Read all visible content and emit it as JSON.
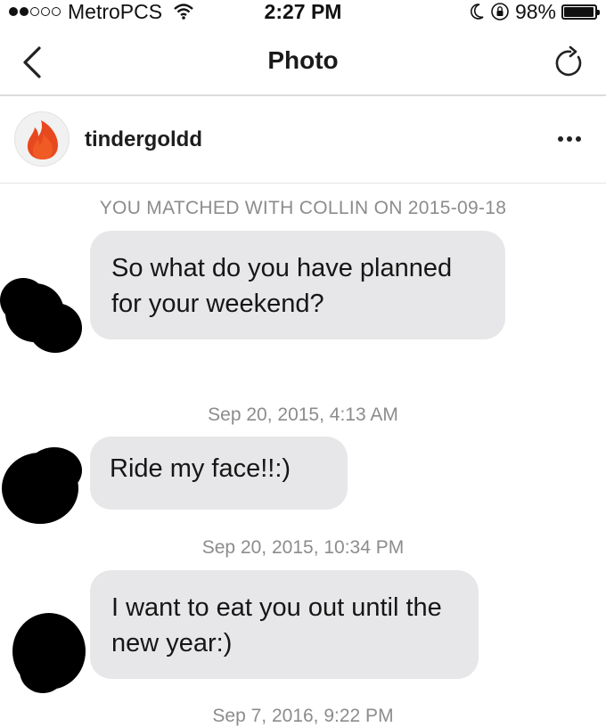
{
  "status_bar": {
    "carrier": "MetroPCS",
    "time": "2:27 PM",
    "battery": "98%",
    "battery_level": 0.98
  },
  "nav": {
    "title": "Photo",
    "back_icon": "chevron-left-icon",
    "refresh_icon": "refresh-icon"
  },
  "profile": {
    "username": "tindergoldd",
    "avatar_icon": "flame-icon",
    "more_icon": "more-icon"
  },
  "chat": {
    "match_text": "YOU MATCHED WITH COLLIN ON 2015-09-18",
    "messages": [
      {
        "text": "So what do you have planned for your weekend?"
      },
      {
        "timestamp": "Sep 20, 2015, 4:13 AM",
        "text": "Ride my face!!:)"
      },
      {
        "timestamp": "Sep 20, 2015, 10:34 PM",
        "text": "I want to eat you out until the new year:)"
      }
    ],
    "cut_timestamp": "Sep 7, 2016, 9:22 PM"
  }
}
